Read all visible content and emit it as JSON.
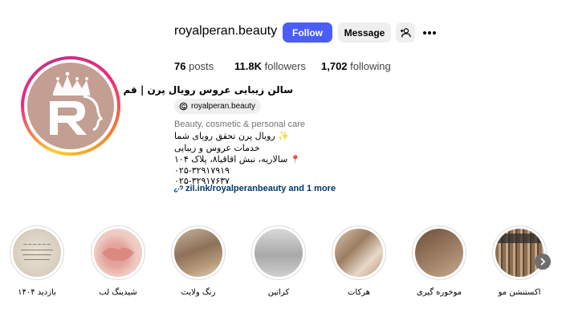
{
  "profile": {
    "username": "royalperan.beauty",
    "follow_label": "Follow",
    "message_label": "Message",
    "suggest_icon": "person-plus-icon",
    "more_icon": "more-horizontal-icon"
  },
  "stats": {
    "posts_count": "76",
    "posts_label": "posts",
    "followers_count": "11.8K",
    "followers_label": "followers",
    "following_count": "1,702",
    "following_label": "following"
  },
  "bio": {
    "name": "سالن زیبایی عروس رویال پرن | قم",
    "threads_handle": "royalperan.beauty",
    "category": "Beauty, cosmetic & personal care",
    "line1": "رویال پرن تحقق رویای شما",
    "line2": "خدمات عروس و زیبایی",
    "line3": "سالاریه، نبش اقاقیا۸، پلاک ۱۰۴",
    "phone1": "۰۲۵-۳۲۹۱۷۹۱۹",
    "phone2": "۰۲۵-۳۲۹۱۷۶۳۷",
    "link_text": "zil.ink/royalperanbeauty and 1 more"
  },
  "highlights": [
    {
      "label": "بازدید ۱۴۰۴"
    },
    {
      "label": "شیدینگ لب"
    },
    {
      "label": "رنگ ولایت"
    },
    {
      "label": "کراتین"
    },
    {
      "label": "هرکات"
    },
    {
      "label": "موخوره گیری"
    },
    {
      "label": "اکستنشن مو"
    }
  ],
  "colors": {
    "follow_button": "#4a5df9",
    "avatar_bg": "#c39e93",
    "link": "#00376b"
  }
}
